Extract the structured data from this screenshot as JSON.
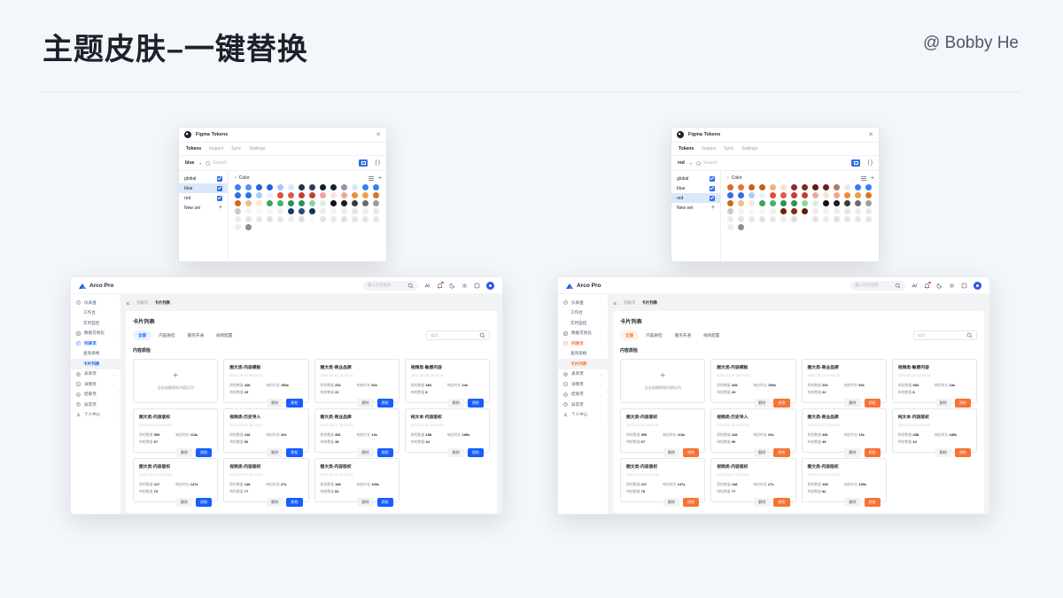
{
  "slide": {
    "title": "主题皮肤–一键替换",
    "author": "@ Bobby He"
  },
  "figma_panels": [
    {
      "id": "blue-theme",
      "window_title": "Figma Tokens",
      "close_label": "✕",
      "tabs": [
        "Tokens",
        "Inspect",
        "Sync",
        "Settings"
      ],
      "active_tab": "Tokens",
      "set_selector": "blue",
      "caret": "▾",
      "search_placeholder": "Search",
      "braces_label": "{ }",
      "sets": [
        {
          "label": "global",
          "checked": true,
          "active": false
        },
        {
          "label": "blue",
          "checked": true,
          "active": true
        },
        {
          "label": "red",
          "checked": true,
          "active": false
        }
      ],
      "new_set_label": "New set",
      "new_set_plus": "+",
      "group_bullet": "▪",
      "group_name": "Color",
      "group_add": "+",
      "swatches": [
        "#3c7eff",
        "#528fff",
        "#2361e0",
        "#1d5fe0",
        "#a7c8ff",
        "#dbe7fb",
        "#20334f",
        "#2b3d59",
        "#121f33",
        "#16233a",
        "#8b97ad",
        "#dce6f5",
        "#2f80f5",
        "#2f80f5",
        "#2f6fe4",
        "#2f6fe4",
        "#a9cdf5",
        "#e9f1fb",
        "#d9503f",
        "#e25a46",
        "#c03f30",
        "#c03f30",
        "#eda79a",
        "#f6e4df",
        "#efa792",
        "#ee8a33",
        "#f0a03c",
        "#d9761f",
        "#cf6a16",
        "#edbe86",
        "#f5ead9",
        "#3aa65c",
        "#43b36a",
        "#2f9150",
        "#2f9150",
        "#86d79f",
        "#d9f0e0",
        "#111111",
        "#1d1d1d",
        "#3a3a3a",
        "#6b6b6b",
        "#9d9d9d",
        "#c9c9c9",
        "#f4f4f4",
        "#f7f7f7",
        "#f6f6f6",
        "#f0f0f0",
        "#173a6b",
        "#1f4a82",
        "#16335c",
        "#ececec",
        "#f2f2f2",
        "#ececec",
        "#e6e6e6",
        "#eeeeee",
        "#e9e9e9",
        "#ebebeb",
        "#e4e4e4",
        "#e8e8e8",
        "#e2e2e2",
        "#e7e7e7",
        "#ededed",
        "#dedede",
        "#fbfbfb",
        "#e4e4e4",
        "#eaeaea",
        "#e2e2e2",
        "#e6e6e6",
        "#dfe7f2",
        "#e6e6e6",
        "#eeeeee",
        "#8d8d8d"
      ]
    },
    {
      "id": "red-theme",
      "window_title": "Figma Tokens",
      "close_label": "✕",
      "tabs": [
        "Tokens",
        "Inspect",
        "Sync",
        "Settings"
      ],
      "active_tab": "Tokens",
      "set_selector": "red",
      "caret": "▾",
      "search_placeholder": "Search",
      "braces_label": "{ }",
      "sets": [
        {
          "label": "global",
          "checked": true,
          "active": false
        },
        {
          "label": "blue",
          "checked": true,
          "active": false
        },
        {
          "label": "red",
          "checked": true,
          "active": true
        }
      ],
      "new_set_label": "New set",
      "new_set_plus": "+",
      "group_bullet": "▪",
      "group_name": "Color",
      "group_add": "+",
      "swatches": [
        "#dc6a2a",
        "#e0782f",
        "#cc5f1e",
        "#c95b1b",
        "#efb184",
        "#f7e2d1",
        "#8a2f20",
        "#7b2d1c",
        "#5e1b10",
        "#6b2113",
        "#ad7a63",
        "#f4e6dc",
        "#2f80f5",
        "#2f80f5",
        "#2f6fe4",
        "#2f6fe4",
        "#a9cdf5",
        "#e9f1fb",
        "#d9503f",
        "#e25a46",
        "#c03f30",
        "#c03f30",
        "#eda79a",
        "#f6e4df",
        "#efa792",
        "#ee8a33",
        "#f0a03c",
        "#d9761f",
        "#cf6a16",
        "#edbe86",
        "#f5ead9",
        "#3aa65c",
        "#43b36a",
        "#2f9150",
        "#2f9150",
        "#86d79f",
        "#d9f0e0",
        "#111111",
        "#1d1d1d",
        "#3a3a3a",
        "#6b6b6b",
        "#9d9d9d",
        "#c9c9c9",
        "#f4f4f4",
        "#f7f7f7",
        "#f6f6f6",
        "#f0f0f0",
        "#6b2113",
        "#7a2c18",
        "#5e1b10",
        "#ececec",
        "#f2f2f2",
        "#ececec",
        "#e6e6e6",
        "#eeeeee",
        "#e9e9e9",
        "#ebebeb",
        "#e4e4e4",
        "#e8e8e8",
        "#e2e2e2",
        "#e7e7e7",
        "#ededed",
        "#dedede",
        "#fbfbfb",
        "#e4e4e4",
        "#eaeaea",
        "#e2e2e2",
        "#e6e6e6",
        "#dfe7f2",
        "#e6e6e6",
        "#eeeeee",
        "#8d8d8d"
      ]
    }
  ],
  "apps": [
    {
      "id": "app-blue",
      "theme": "blue",
      "accent": "#165dff",
      "brand": "Arco Pro",
      "search_placeholder": "输入内容搜索",
      "topbar_icons": [
        "search-icon",
        "language-icon",
        "bell-icon",
        "moon-icon",
        "settings-icon",
        "help-icon"
      ],
      "sidebar": [
        {
          "label": "仪表盘",
          "icon": "dashboard-icon",
          "level": 0,
          "expandable": true,
          "arrow": "⌃"
        },
        {
          "label": "工作台",
          "icon": "",
          "level": 1
        },
        {
          "label": "实时监控",
          "icon": "",
          "level": 1
        },
        {
          "label": "数据可视化",
          "icon": "chart-icon",
          "level": 0,
          "expandable": true,
          "arrow": "⌄"
        },
        {
          "label": "列表页",
          "icon": "list-icon",
          "level": 0,
          "expandable": true,
          "arrow": "⌃",
          "accent": true
        },
        {
          "label": "查询表格",
          "icon": "",
          "level": 1
        },
        {
          "label": "卡片列表",
          "icon": "",
          "level": 1,
          "selected": true,
          "accent": true
        },
        {
          "label": "表单页",
          "icon": "form-icon",
          "level": 0,
          "expandable": true,
          "arrow": "⌄"
        },
        {
          "label": "详情页",
          "icon": "detail-icon",
          "level": 0,
          "expandable": true,
          "arrow": "⌄"
        },
        {
          "label": "结果页",
          "icon": "result-icon",
          "level": 0,
          "expandable": true,
          "arrow": "⌄"
        },
        {
          "label": "异常页",
          "icon": "exception-icon",
          "level": 0,
          "expandable": true,
          "arrow": "⌄"
        },
        {
          "label": "个人中心",
          "icon": "user-icon",
          "level": 0,
          "expandable": true,
          "arrow": "⌄"
        }
      ],
      "breadcrumb": [
        "列表页",
        "卡片列表"
      ],
      "breadcrumb_sep": "/",
      "page_title": "卡片列表",
      "tabs": [
        "全部",
        "内容质检",
        "服务开通",
        "规则配置"
      ],
      "active_tab": "全部",
      "tab_search_placeholder": "搜索",
      "section_title": "内容质检",
      "add_card": {
        "plus": "+",
        "text": "点击创建质检内容队列"
      },
      "stat_labels": {
        "a": "质检数量",
        "b": "响应时长",
        "c": "待检数量"
      },
      "actions": {
        "delete": "删除",
        "view": "质检"
      },
      "cards": [
        {
          "title": "图文类-内容模板",
          "date": "2022-03-30 16:04:31",
          "a": "428",
          "b": "150a",
          "c": "29"
        },
        {
          "title": "图文类-商业品牌",
          "date": "2022-03-14 16:04:31",
          "a": "202",
          "b": "52s",
          "c": "22"
        },
        {
          "title": "视频类-敏感内容",
          "date": "2022-04-03 16:04:31",
          "a": "384",
          "b": "24s",
          "c": "8"
        },
        {
          "title": "图文类-内容版权",
          "date": "2022-03-28 16:04:31",
          "a": "509",
          "b": "113s",
          "c": "67"
        },
        {
          "title": "视频类-历史导入",
          "date": "2022-03-30 16:04:31",
          "a": "418",
          "b": "20s",
          "c": "90"
        },
        {
          "title": "图文类-商业品牌",
          "date": "2022-03-27 16:04:31",
          "a": "381",
          "b": "13s",
          "c": "48"
        },
        {
          "title": "纯文本-内容版权",
          "date": "2022-03-24 16:04:31",
          "a": "288",
          "b": "185s",
          "c": "44"
        },
        {
          "title": "图文类-内容版权",
          "date": "2022-03-24 16:04:31",
          "a": "217",
          "b": "147s",
          "c": "75"
        },
        {
          "title": "视频类-内容版权",
          "date": "2022-03-07 16:04:31",
          "a": "148",
          "b": "27s",
          "c": "77"
        },
        {
          "title": "图文类-内容版权",
          "date": "2022-03-11 16:04:31",
          "a": "168",
          "b": "109s",
          "c": "82"
        }
      ]
    },
    {
      "id": "app-orange",
      "theme": "orange",
      "accent": "#f77234",
      "brand": "Arco Pro",
      "search_placeholder": "输入内容搜索",
      "topbar_icons": [
        "search-icon",
        "language-icon",
        "bell-icon",
        "moon-icon",
        "settings-icon",
        "help-icon"
      ],
      "sidebar": [
        {
          "label": "仪表盘",
          "icon": "dashboard-icon",
          "level": 0,
          "expandable": true,
          "arrow": "⌃"
        },
        {
          "label": "工作台",
          "icon": "",
          "level": 1
        },
        {
          "label": "实时监控",
          "icon": "",
          "level": 1
        },
        {
          "label": "数据可视化",
          "icon": "chart-icon",
          "level": 0,
          "expandable": true,
          "arrow": "⌄"
        },
        {
          "label": "列表页",
          "icon": "list-icon",
          "level": 0,
          "expandable": true,
          "arrow": "⌃",
          "accent": true
        },
        {
          "label": "查询表格",
          "icon": "",
          "level": 1
        },
        {
          "label": "卡片列表",
          "icon": "",
          "level": 1,
          "selected": true,
          "accent": true
        },
        {
          "label": "表单页",
          "icon": "form-icon",
          "level": 0,
          "expandable": true,
          "arrow": "⌄"
        },
        {
          "label": "详情页",
          "icon": "detail-icon",
          "level": 0,
          "expandable": true,
          "arrow": "⌄"
        },
        {
          "label": "结果页",
          "icon": "result-icon",
          "level": 0,
          "expandable": true,
          "arrow": "⌄"
        },
        {
          "label": "异常页",
          "icon": "exception-icon",
          "level": 0,
          "expandable": true,
          "arrow": "⌄"
        },
        {
          "label": "个人中心",
          "icon": "user-icon",
          "level": 0,
          "expandable": true,
          "arrow": "⌄"
        }
      ],
      "breadcrumb": [
        "列表页",
        "卡片列表"
      ],
      "breadcrumb_sep": "/",
      "page_title": "卡片列表",
      "tabs": [
        "全部",
        "内容质检",
        "服务开通",
        "规则配置"
      ],
      "active_tab": "全部",
      "tab_search_placeholder": "搜索",
      "section_title": "内容质检",
      "add_card": {
        "plus": "+",
        "text": "点击创建质检内容队列"
      },
      "stat_labels": {
        "a": "质检数量",
        "b": "响应时长",
        "c": "待检数量"
      },
      "actions": {
        "delete": "删除",
        "view": "质检"
      },
      "cards": [
        {
          "title": "图文类-内容模板",
          "date": "2022-03-30 16:04:31",
          "a": "428",
          "b": "150a",
          "c": "29"
        },
        {
          "title": "图文类-商业品牌",
          "date": "2022-03-14 16:04:31",
          "a": "202",
          "b": "52s",
          "c": "22"
        },
        {
          "title": "视频类-敏感内容",
          "date": "2022-04-03 16:04:31",
          "a": "384",
          "b": "24s",
          "c": "8"
        },
        {
          "title": "图文类-内容版权",
          "date": "2022-03-28 16:04:31",
          "a": "509",
          "b": "113s",
          "c": "67"
        },
        {
          "title": "视频类-历史导入",
          "date": "2022-03-30 16:04:31",
          "a": "418",
          "b": "20s",
          "c": "90"
        },
        {
          "title": "图文类-商业品牌",
          "date": "2022-03-27 16:04:31",
          "a": "381",
          "b": "13s",
          "c": "48"
        },
        {
          "title": "纯文本-内容版权",
          "date": "2022-03-24 16:04:31",
          "a": "288",
          "b": "185s",
          "c": "44"
        },
        {
          "title": "图文类-内容版权",
          "date": "2022-03-24 16:04:31",
          "a": "217",
          "b": "147s",
          "c": "75"
        },
        {
          "title": "视频类-内容版权",
          "date": "2022-03-07 16:04:31",
          "a": "148",
          "b": "27s",
          "c": "77"
        },
        {
          "title": "图文类-内容版权",
          "date": "2022-03-11 16:04:31",
          "a": "168",
          "b": "109s",
          "c": "82"
        }
      ]
    }
  ]
}
